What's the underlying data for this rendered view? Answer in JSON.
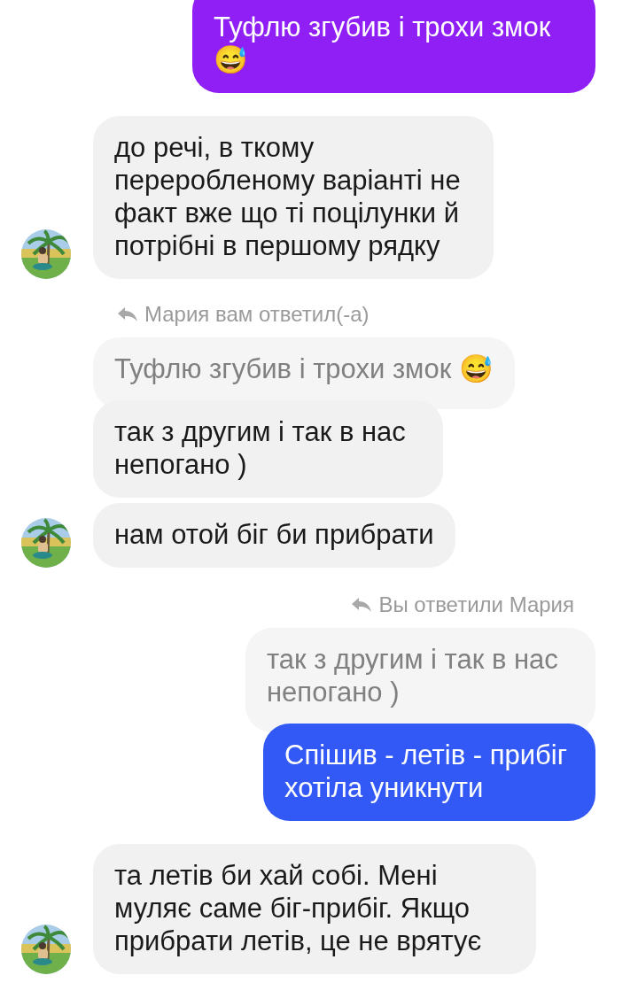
{
  "messages": [
    {
      "kind": "outgoing",
      "color": "#8f1ff5",
      "text": "Туфлю згубив і трохи змок 😅"
    },
    {
      "kind": "incoming",
      "avatar": true,
      "text": "до речі, в ткому переробленому варіанті не факт вже що ті поцілунки й потрібні в першому рядку"
    },
    {
      "kind": "incoming_reply",
      "label": "Мария вам ответил(-а)",
      "quote": "Туфлю згубив і трохи змок 😅",
      "text": "так з другим і так в нас непогано )"
    },
    {
      "kind": "incoming",
      "avatar": true,
      "text": "нам отой біг би прибрати"
    },
    {
      "kind": "outgoing_reply",
      "label": "Вы ответили Мария",
      "quote": "так з другим і так в нас непогано )",
      "text": "Спішив - летів - прибіг хотіла уникнути",
      "color": "#3259f5"
    },
    {
      "kind": "incoming",
      "avatar": true,
      "text": "та летів би хай собі. Мені муляє саме біг-прибіг. Якщо прибрати летів, це не врятує"
    }
  ]
}
